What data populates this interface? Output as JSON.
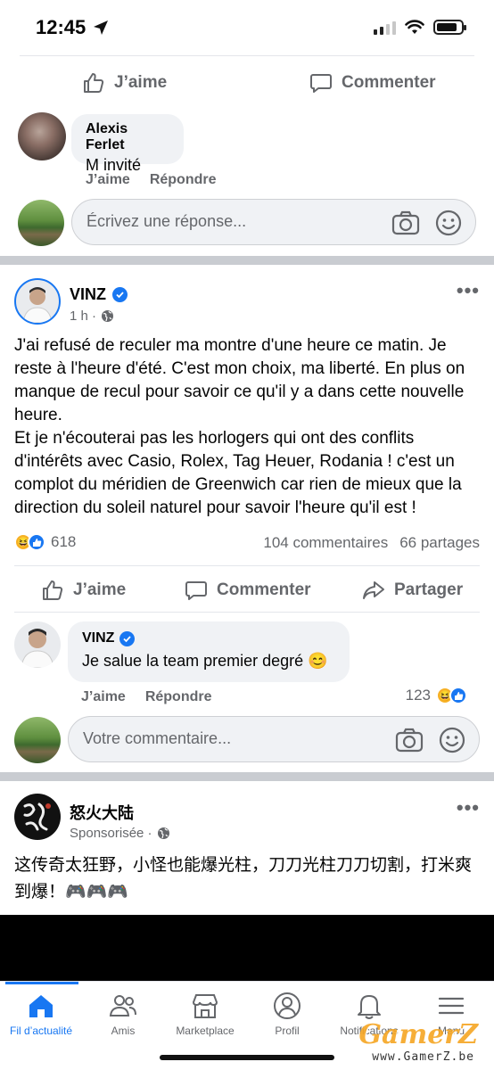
{
  "status_bar": {
    "time": "12:45"
  },
  "top_actions": {
    "like": "J’aime",
    "comment": "Commenter"
  },
  "comment1": {
    "author": "Alexis Ferlet",
    "text": "M invité",
    "like": "J’aime",
    "reply": "Répondre"
  },
  "reply_box1": {
    "placeholder": "Écrivez une réponse..."
  },
  "post": {
    "author": "VINZ",
    "time": "1 h ·",
    "paragraphs": [
      "J'ai refusé de reculer ma montre d'une heure ce matin. Je reste à l'heure d'été. C'est mon choix, ma liberté. En plus on manque de recul pour savoir ce qu'il y a dans cette nouvelle heure.",
      "Et je n'écouterai pas les horlogers qui ont des conflits d'intérêts avec Casio, Rolex, Tag Heuer, Rodania ! c'est un complot du méridien de Greenwich car rien de mieux que la direction du soleil naturel pour savoir l'heure qu'il est !"
    ],
    "reactions_count": "618",
    "comments_count": "104 commentaires",
    "shares_count": "66 partages",
    "actions": {
      "like": "J’aime",
      "comment": "Commenter",
      "share": "Partager"
    }
  },
  "comment2": {
    "author": "VINZ",
    "text": "Je salue la team premier degré 😊",
    "like": "J’aime",
    "reply": "Répondre",
    "reactions_count": "123"
  },
  "comment_box": {
    "placeholder": "Votre commentaire..."
  },
  "sponsored": {
    "author": "怒火大陆",
    "label": "Sponsorisée ·",
    "text": "这传奇太狂野，小怪也能爆光柱，刀刀光柱刀刀切割，打米爽到爆！🎮🎮🎮"
  },
  "tabs": [
    {
      "label": "Fil d’actualité"
    },
    {
      "label": "Amis"
    },
    {
      "label": "Marketplace"
    },
    {
      "label": "Profil"
    },
    {
      "label": "Notifications"
    },
    {
      "label": "Menu"
    }
  ],
  "watermark": {
    "brand": "GamerZ",
    "url": "www.GamerZ.be"
  },
  "colors": {
    "accent": "#1877f2",
    "secondary_text": "#65676b",
    "bubble": "#f0f2f5"
  }
}
